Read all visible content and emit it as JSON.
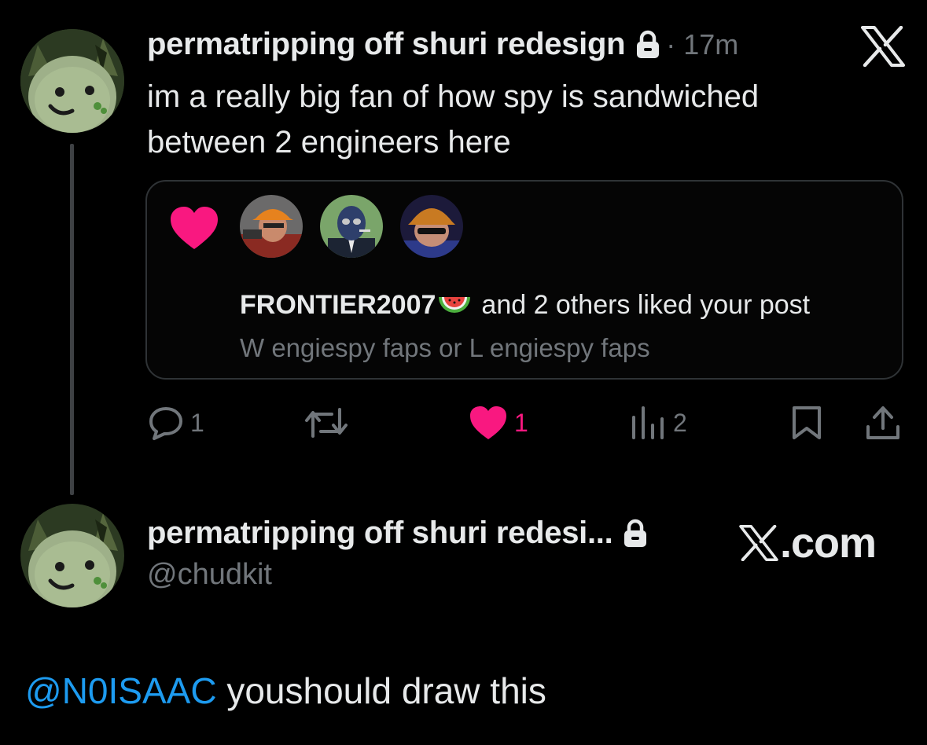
{
  "tweet": {
    "display_name": "permatripping off shuri redesign",
    "time": "17m",
    "text": "im a really big fan of how spy is sandwiched between 2 engineers here",
    "notification": {
      "user": "FRONTIER2007",
      "emoji": "watermelon-icon",
      "liked_text": "and 2 others liked your post",
      "post_text": "W engiespy faps or L engiespy faps"
    },
    "actions": {
      "replies": "1",
      "retweets": "",
      "likes": "1",
      "views": "2"
    }
  },
  "source": {
    "display_name": "permatripping off shuri redesi...",
    "handle": "@chudkit",
    "site": ".com"
  },
  "reply": {
    "mention": "@N0ISAAC",
    "text": " youshould draw this"
  },
  "colors": {
    "background": "#000000",
    "text": "#e7e9ea",
    "muted": "#71767b",
    "like_pink": "#f91880",
    "link_blue": "#1d9bf0"
  }
}
